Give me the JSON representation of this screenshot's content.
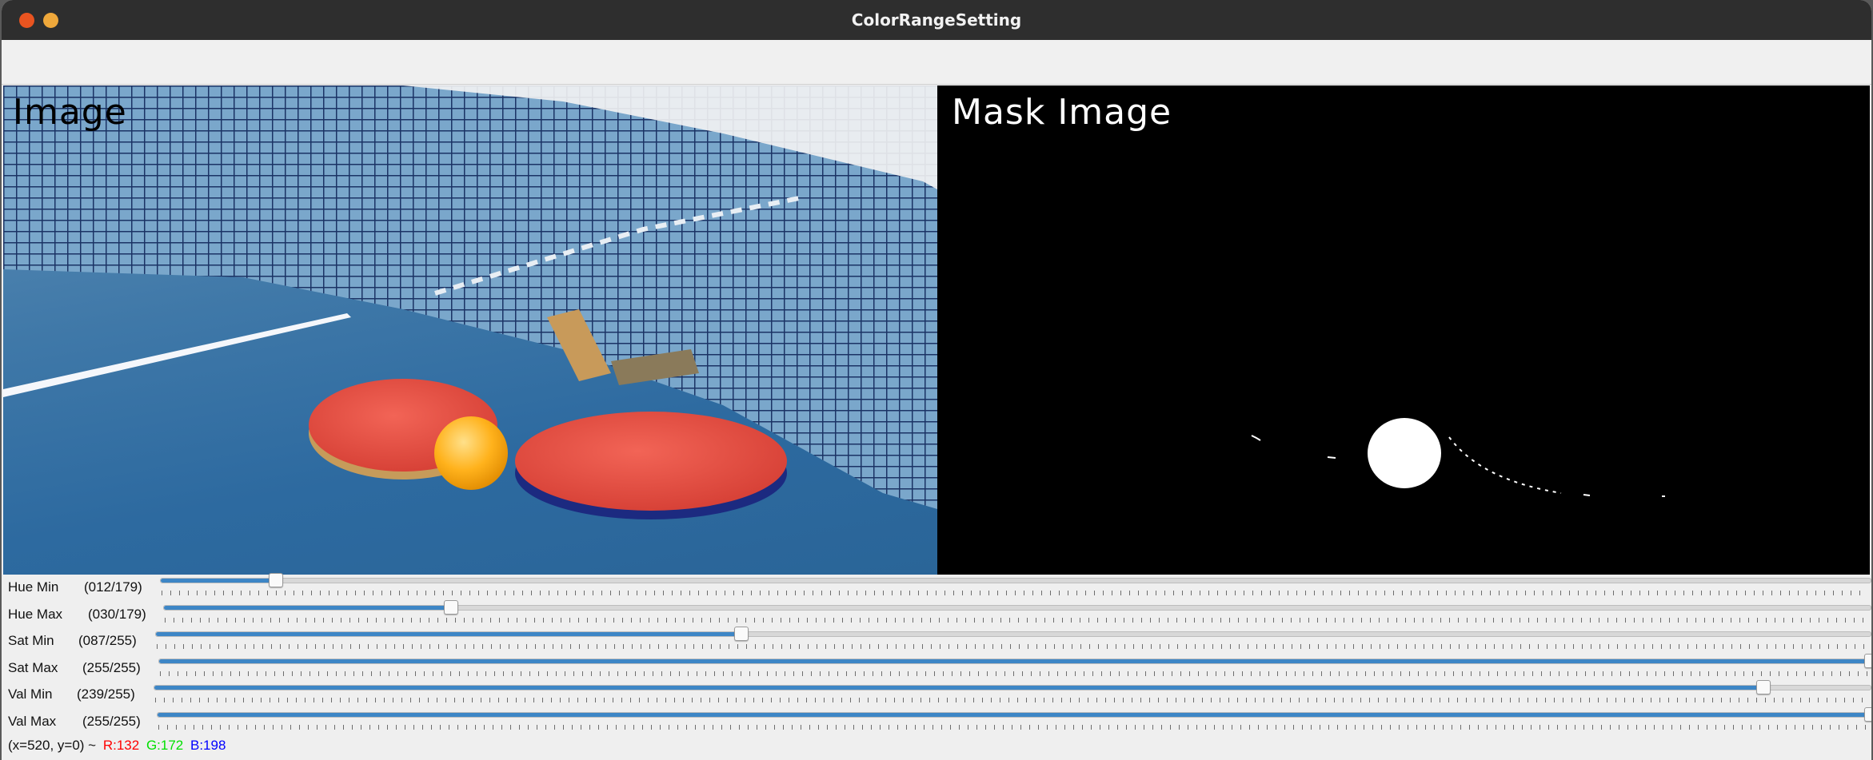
{
  "window": {
    "title": "ColorRangeSetting"
  },
  "images": {
    "left_label": "Image",
    "right_label": "Mask Image"
  },
  "trackbars": [
    {
      "label": "Hue Min",
      "value_text": "(012/179)",
      "value": 12,
      "max": 179
    },
    {
      "label": "Hue Max",
      "value_text": "(030/179)",
      "value": 30,
      "max": 179
    },
    {
      "label": "Sat Min",
      "value_text": "(087/255)",
      "value": 87,
      "max": 255
    },
    {
      "label": "Sat Max",
      "value_text": "(255/255)",
      "value": 255,
      "max": 255
    },
    {
      "label": "Val Min",
      "value_text": "(239/255)",
      "value": 239,
      "max": 255
    },
    {
      "label": "Val Max",
      "value_text": "(255/255)",
      "value": 255,
      "max": 255
    }
  ],
  "status": {
    "coords": "(x=520, y=0) ~",
    "r": "R:132",
    "g": "G:172",
    "b": "B:198",
    "colors": {
      "r": "#ff0000",
      "g": "#00e000",
      "b": "#0000ff"
    }
  },
  "colors": {
    "accent": "#3d86c6",
    "titlebar": "#2e2e2e",
    "close": "#e95420",
    "minimize": "#efa83b"
  }
}
